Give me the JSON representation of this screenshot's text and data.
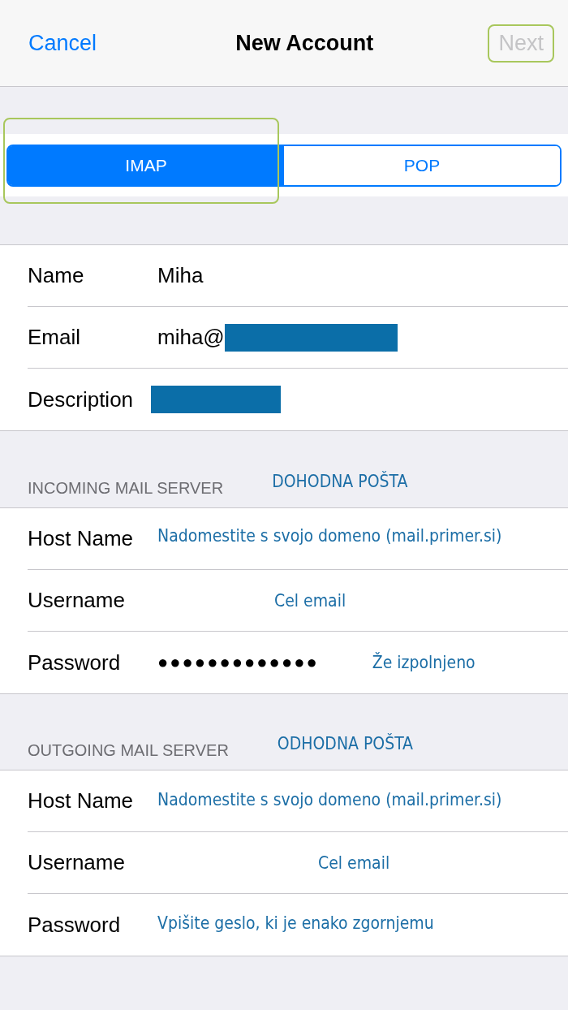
{
  "nav": {
    "cancel": "Cancel",
    "title": "New Account",
    "next": {
      "label": "Next",
      "disabled": true,
      "highlighted": true
    }
  },
  "segments": [
    {
      "label": "IMAP",
      "selected": true,
      "highlighted": true
    },
    {
      "label": "POP",
      "selected": false,
      "highlighted": false
    }
  ],
  "account_fields": [
    {
      "label": "Name",
      "value": "Miha"
    },
    {
      "label": "Email",
      "value": "miha@",
      "redacted": true
    },
    {
      "label": "Description",
      "redacted": true
    }
  ],
  "incoming": {
    "header": "INCOMING MAIL SERVER",
    "note": "DOHODNA POŠTA",
    "fields": [
      {
        "kind": "start",
        "label": "Host Name",
        "note": "Nadomestite s svojo domeno (mail.primer.si)"
      },
      {
        "kind": "center",
        "label": "Username",
        "note": "Cel email"
      },
      {
        "kind": "after",
        "label": "Password",
        "value": "●●●●●●●●●●●●●",
        "note": "Že izpolnjeno"
      }
    ]
  },
  "outgoing": {
    "header": "OUTGOING MAIL SERVER",
    "note": "ODHODNA POŠTA",
    "fields": [
      {
        "kind": "start",
        "label": "Host Name",
        "note": "Nadomestite s svojo domeno (mail.primer.si)"
      },
      {
        "kind": "center",
        "label": "Username",
        "note": "Cel email"
      },
      {
        "kind": "start",
        "label": "Password",
        "note": "Vpišite geslo, ki je enako zgornjemu"
      }
    ]
  }
}
